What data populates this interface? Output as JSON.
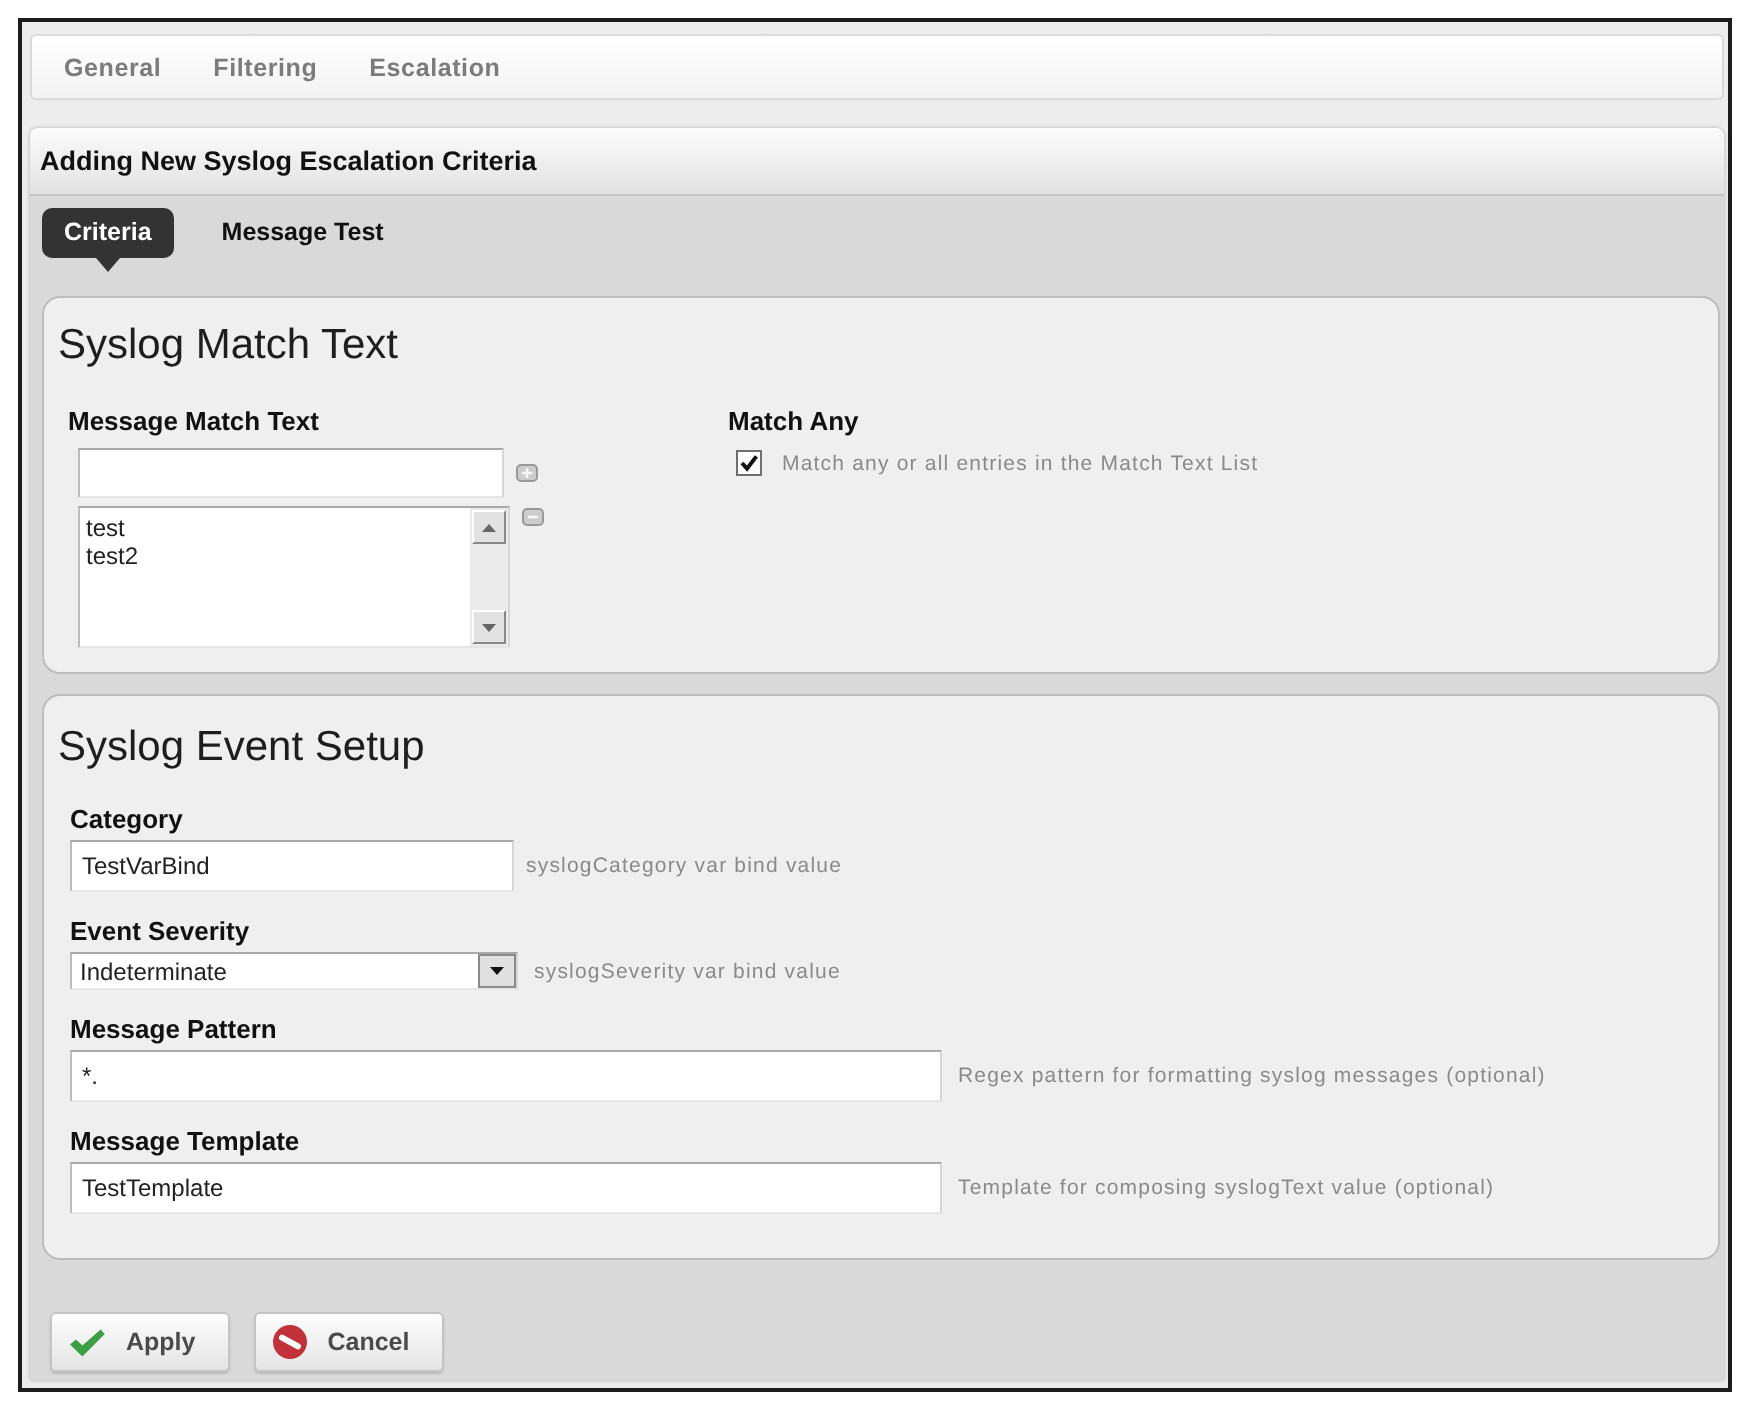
{
  "top_tabs": [
    {
      "label": "General",
      "selected": false
    },
    {
      "label": "Filtering",
      "selected": false
    },
    {
      "label": "Escalation",
      "selected": false
    }
  ],
  "panel": {
    "title": "Adding New Syslog Escalation Criteria"
  },
  "sub_tabs": [
    {
      "label": "Criteria",
      "selected": true
    },
    {
      "label": "Message Test",
      "selected": false
    }
  ],
  "match_section": {
    "title": "Syslog Match Text",
    "match_text": {
      "label": "Message Match Text",
      "items": [
        "test",
        "test2"
      ]
    },
    "match_any": {
      "label": "Match Any",
      "option": "Match any or all entries in the Match Text List",
      "checked": true
    }
  },
  "event_section": {
    "title": "Syslog Event Setup",
    "fields": [
      {
        "kind": "text",
        "label": "Category",
        "value": "TestVarBind",
        "hint": "syslogCategory var bind value"
      },
      {
        "kind": "select",
        "label": "Event Severity",
        "value": "Indeterminate",
        "hint": "syslogSeverity var bind value"
      },
      {
        "kind": "text",
        "label": "Message Pattern",
        "value": "*.",
        "hint": "Regex pattern for formatting syslog messages (optional)"
      },
      {
        "kind": "text",
        "label": "Message Template",
        "value": "TestTemplate",
        "hint": "Template for composing syslogText value (optional)"
      }
    ]
  },
  "buttons": [
    {
      "kind": "apply",
      "label": "Apply"
    },
    {
      "kind": "cancel",
      "label": "Cancel"
    }
  ]
}
